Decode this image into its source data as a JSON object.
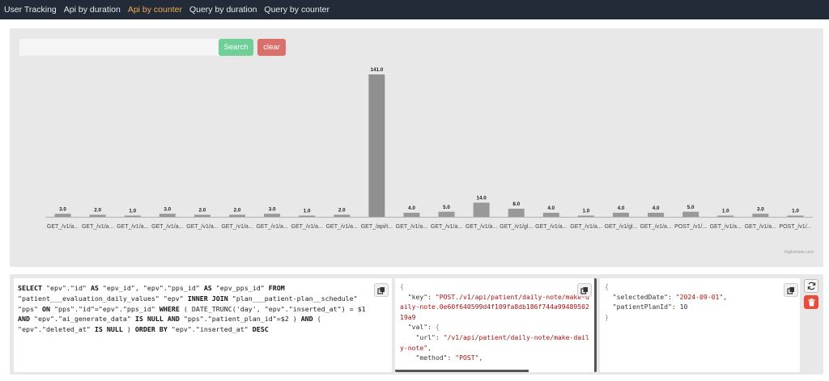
{
  "nav": {
    "items": [
      {
        "label": "User Tracking",
        "active": false
      },
      {
        "label": "Api by duration",
        "active": false
      },
      {
        "label": "Api by counter",
        "active": true
      },
      {
        "label": "Query by duration",
        "active": false
      },
      {
        "label": "Query by counter",
        "active": false
      }
    ],
    "active_color": "#f0ad4e"
  },
  "search": {
    "value": "",
    "placeholder": ""
  },
  "buttons": {
    "search_label": "Search",
    "clear_label": "clear"
  },
  "colors": {
    "bar": "#999999",
    "bar_selected": "#909090",
    "search_btn": "#6fcf97",
    "clear_btn": "#d9706b",
    "delete_btn": "#e74c3c"
  },
  "chart_data": {
    "type": "bar",
    "categories": [
      "GET_/v1/a...",
      "GET_/v1/a...",
      "GET_/v1/a...",
      "GET_/v1/a...",
      "GET_/v1/a...",
      "GET_/v1/a...",
      "GET_/v1/a...",
      "GET_/v1/a...",
      "GET_/v1/a...",
      "GET_/api/t...",
      "GET_/v1/a...",
      "GET_/v1/a...",
      "GET_/v1/a...",
      "GET_/v1/gl...",
      "GET_/v1/a...",
      "GET_/v1/a...",
      "GET_/v1/gl...",
      "GET_/v1/a...",
      "POST_/v1/...",
      "GET_/v1/a...",
      "GET_/v1/a...",
      "POST_/v1/..."
    ],
    "values": [
      3.0,
      2.0,
      1.0,
      3.0,
      2.0,
      2.0,
      3.0,
      1.0,
      2.0,
      141.0,
      4.0,
      5.0,
      14.0,
      8.0,
      4.0,
      1.0,
      4.0,
      4.0,
      5.0,
      1.0,
      3.0,
      1.0
    ],
    "value_labels": [
      "3.0",
      "2.0",
      "1.0",
      "3.0",
      "2.0",
      "2.0",
      "3.0",
      "1.0",
      "2.0",
      "141.0",
      "4.0",
      "5.0",
      "14.0",
      "8.0",
      "4.0",
      "1.0",
      "4.0",
      "4.0",
      "5.0",
      "1.0",
      "3.0",
      "1.0"
    ],
    "ylim": [
      0,
      141
    ],
    "grid": false,
    "credit": "Highcharts.com"
  },
  "query": {
    "sql_parts": [
      {
        "t": "SELECT",
        "k": true
      },
      {
        "t": " \"epv\".\"id\" ",
        "k": false
      },
      {
        "t": "AS",
        "k": true
      },
      {
        "t": " \"epv_id\", \"epv\".\"pps_id\" ",
        "k": false
      },
      {
        "t": "AS",
        "k": true
      },
      {
        "t": " \"epv_pps_id\" ",
        "k": false
      },
      {
        "t": "FROM",
        "k": true
      },
      {
        "t": " \"patient___evaluation_daily_values\" \"epv\" ",
        "k": false
      },
      {
        "t": "INNER JOIN",
        "k": true
      },
      {
        "t": " \"plan___patient-plan__schedule\" \"pps\" ",
        "k": false
      },
      {
        "t": "ON",
        "k": true
      },
      {
        "t": " \"pps\".\"id\"=\"epv\".\"pps_id\" ",
        "k": false
      },
      {
        "t": "WHERE",
        "k": true
      },
      {
        "t": " ( DATE_TRUNC('day', \"epv\".\"inserted_at\") = $1 ",
        "k": false
      },
      {
        "t": "AND",
        "k": true
      },
      {
        "t": " \"epv\".\"ai_generate_data\"  ",
        "k": false
      },
      {
        "t": "IS NULL AND",
        "k": true
      },
      {
        "t": " \"pps\".\"patient_plan_id\"=$2 ) ",
        "k": false
      },
      {
        "t": "AND",
        "k": true
      },
      {
        "t": " ( \"epv\".\"deleted_at\" ",
        "k": false
      },
      {
        "t": "IS NULL",
        "k": true
      },
      {
        "t": " ) ",
        "k": false
      },
      {
        "t": "ORDER BY",
        "k": true
      },
      {
        "t": " \"epv\".\"inserted_at\" ",
        "k": false
      },
      {
        "t": "DESC",
        "k": true
      }
    ],
    "key_json": {
      "key": "\"POST./v1/api/patient/daily-note/make-daily-note.0e60f640599d4f109fa8db186f744a9948950219a9",
      "url": "\"/v1/api/patient/daily-note/make-daily-note\"",
      "method": "\"POST\""
    },
    "params_json": {
      "selectedDate": "\"2024-09-01\"",
      "patientPlanId": "10"
    }
  }
}
